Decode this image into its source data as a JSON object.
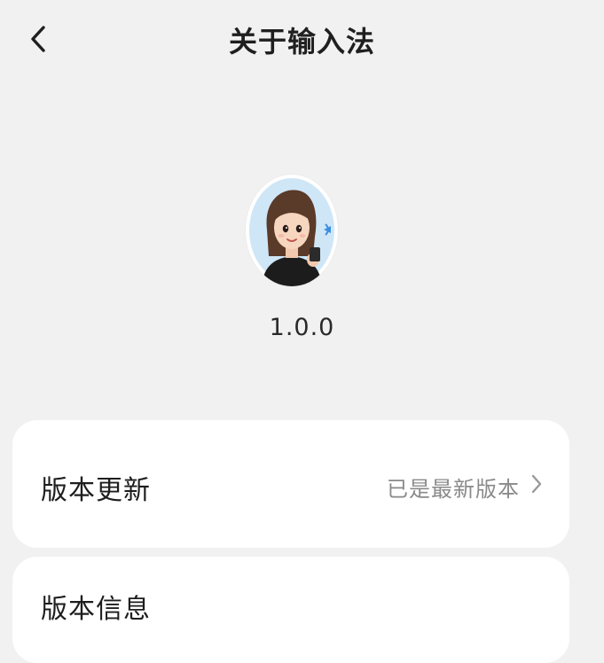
{
  "header": {
    "back_icon": "chevron-left-icon",
    "title": "关于输入法"
  },
  "app": {
    "avatar_icon": "cartoon-girl-avatar",
    "version": "1.0.0"
  },
  "settings": {
    "update": {
      "label": "版本更新",
      "value": "已是最新版本",
      "chevron_icon": "chevron-right-icon"
    },
    "info": {
      "label": "版本信息"
    }
  },
  "colors": {
    "background": "#f1f1f1",
    "card": "#ffffff",
    "avatar_bg": "#cfe6f7",
    "accent_blue": "#3b8ee0"
  }
}
